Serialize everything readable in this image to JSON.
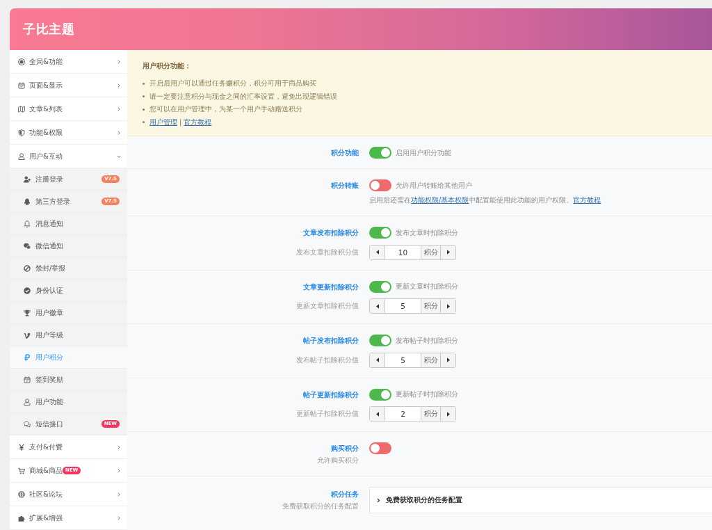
{
  "header": {
    "title": "子比主题"
  },
  "sidebar": {
    "items": [
      {
        "label": "全局&功能",
        "expanded": false
      },
      {
        "label": "页面&显示",
        "expanded": false
      },
      {
        "label": "文章&列表",
        "expanded": false
      },
      {
        "label": "功能&权限",
        "expanded": false
      },
      {
        "label": "用户&互动",
        "expanded": true,
        "children": [
          {
            "label": "注册登录",
            "selected": false,
            "badge": {
              "text": "V7.5",
              "color": "#f7825f"
            }
          },
          {
            "label": "第三方登录",
            "selected": false,
            "badge": {
              "text": "V7.5",
              "color": "#f7825f"
            }
          },
          {
            "label": "消息通知",
            "selected": false
          },
          {
            "label": "微信通知",
            "selected": false
          },
          {
            "label": "禁封/举报",
            "selected": false
          },
          {
            "label": "身份认证",
            "selected": false
          },
          {
            "label": "用户徽章",
            "selected": false
          },
          {
            "label": "用户等级",
            "selected": false
          },
          {
            "label": "用户积分",
            "selected": true
          },
          {
            "label": "签到奖励",
            "selected": false
          },
          {
            "label": "用户功能",
            "selected": false
          },
          {
            "label": "短信接口",
            "selected": false,
            "badge": {
              "text": "NEW",
              "color": "#f5355e"
            }
          }
        ]
      },
      {
        "label": "支付&付费",
        "expanded": false
      },
      {
        "label": "商城&商品",
        "expanded": false,
        "badge": {
          "text": "NEW",
          "color": "#f5355e"
        }
      },
      {
        "label": "社区&论坛",
        "expanded": false
      },
      {
        "label": "扩展&增强",
        "expanded": false
      }
    ]
  },
  "notice": {
    "title": "用户积分功能：",
    "items": [
      "开启后用户可以通过任务赚积分，积分可用于商品购买",
      "请一定要注意积分与现金之间的汇率设置，避免出现逻辑错误",
      "您可以在用户管理中，为某一个用户手动赠送积分"
    ],
    "links": {
      "items": [
        "用户管理",
        "官方教程"
      ],
      "separator": "|"
    }
  },
  "rows": [
    {
      "kind": "toggle",
      "label": "积分功能",
      "switch": {
        "on": true,
        "text": "启用用户积分功能"
      }
    },
    {
      "kind": "toggle",
      "label": "积分转账",
      "switch": {
        "on": false,
        "text": "允许用户转账给其他用户"
      },
      "note": [
        {
          "text": "启用后还需在",
          "link": false
        },
        {
          "text": "功能权限/基本权限",
          "link": true
        },
        {
          "text": "中配置能使用此功能的用户权限。",
          "link": false
        },
        {
          "text": "官方教程",
          "link": true
        }
      ]
    },
    {
      "kind": "toggle-number",
      "label": "文章发布扣除积分",
      "switch": {
        "on": true,
        "text": "发布文章时扣除积分"
      },
      "number": {
        "label": "发布文章扣除积分值",
        "value": "10",
        "unit": "积分"
      }
    },
    {
      "kind": "toggle-number",
      "label": "文章更新扣除积分",
      "switch": {
        "on": true,
        "text": "更新文章时扣除积分"
      },
      "number": {
        "label": "更新文章扣除积分值",
        "value": "5",
        "unit": "积分"
      }
    },
    {
      "kind": "toggle-number",
      "label": "帖子发布扣除积分",
      "switch": {
        "on": true,
        "text": "发布帖子时扣除积分"
      },
      "number": {
        "label": "发布帖子扣除积分值",
        "value": "5",
        "unit": "积分"
      }
    },
    {
      "kind": "toggle-number",
      "label": "帖子更新扣除积分",
      "switch": {
        "on": true,
        "text": "更新帖子时扣除积分"
      },
      "number": {
        "label": "更新帖子扣除积分值",
        "value": "2",
        "unit": "积分"
      }
    },
    {
      "kind": "toggle",
      "label": "购买积分",
      "subtitle": "允许购买积分",
      "switch": {
        "on": false
      }
    },
    {
      "kind": "accordion",
      "label": "积分任务",
      "subtitle": "免费获取积分的任务配置",
      "accordion": {
        "title": "免费获取积分的任务配置",
        "expanded": false
      }
    }
  ]
}
